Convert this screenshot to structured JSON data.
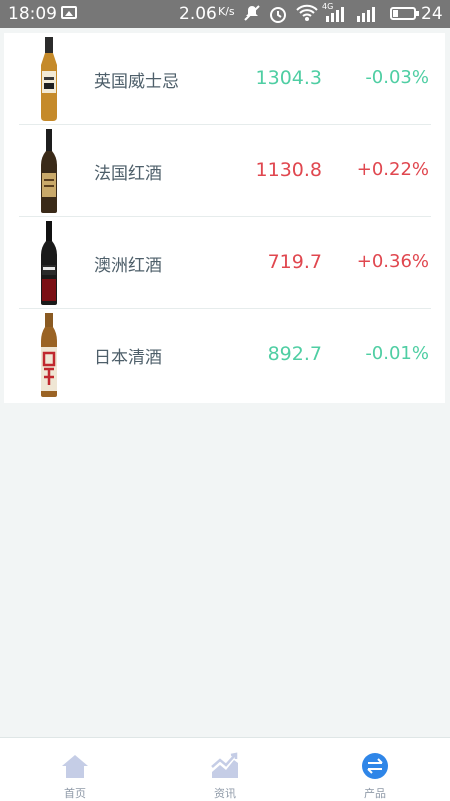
{
  "status_bar": {
    "time": "18:09",
    "speed": "2.06",
    "speed_unit": "K/s",
    "signal_4g": "4G",
    "battery": "24",
    "icons": [
      "image-icon",
      "mute-icon",
      "alarm-icon",
      "wifi-icon",
      "signal-icon",
      "signal-icon",
      "battery-icon"
    ]
  },
  "products": [
    {
      "name": "英国威士忌",
      "price": "1304.3",
      "change": "-0.03%",
      "trend": "down",
      "icon": "whisky-bottle"
    },
    {
      "name": "法国红酒",
      "price": "1130.8",
      "change": "+0.22%",
      "trend": "up",
      "icon": "wine-bottle"
    },
    {
      "name": "澳洲红酒",
      "price": "719.7",
      "change": "+0.36%",
      "trend": "up",
      "icon": "wine-bottle"
    },
    {
      "name": "日本清酒",
      "price": "892.7",
      "change": "-0.01%",
      "trend": "down",
      "icon": "sake-bottle"
    }
  ],
  "bottom_nav": {
    "items": [
      {
        "label": "首页",
        "icon": "home-icon"
      },
      {
        "label": "资讯",
        "icon": "chart-icon"
      },
      {
        "label": "产品",
        "icon": "exchange-icon"
      }
    ],
    "active": "产品"
  },
  "colors": {
    "up": "#e0474f",
    "down": "#4fcea3",
    "nav_icon": "#c5cde6",
    "nav_active": "#2f86e8"
  }
}
